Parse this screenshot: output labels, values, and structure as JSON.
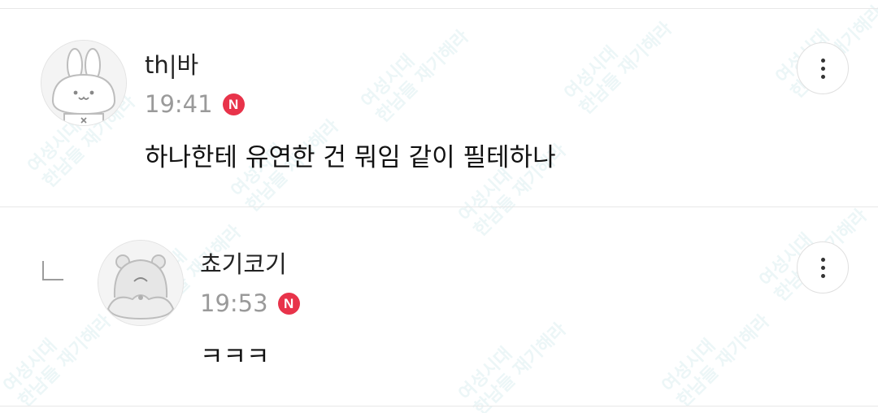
{
  "watermark": {
    "line1": "여성시대",
    "line2": "한남들 재기해라"
  },
  "comments": [
    {
      "username": "th|바",
      "time": "19:41",
      "badge": "N",
      "content": "하나한테 유연한 건 뭐임 같이 필테하나",
      "avatar": "bunny-avatar-icon"
    },
    {
      "username": "쵸기코기",
      "time": "19:53",
      "badge": "N",
      "content": "ㅋㅋㅋ",
      "avatar": "bear-avatar-icon"
    }
  ],
  "colors": {
    "badge": "#e8334a",
    "time": "#9a9a9a",
    "divider": "#e8e8e8"
  }
}
